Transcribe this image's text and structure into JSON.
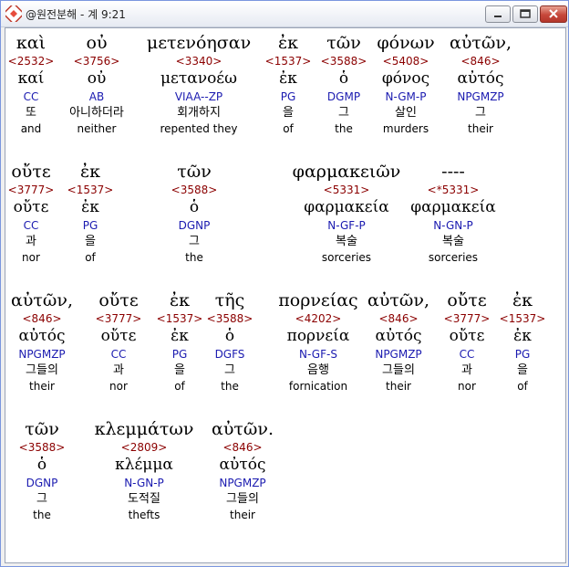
{
  "window": {
    "title": "@원전분해 - 계 9:21",
    "icon": "app-icon",
    "buttons": [
      "minimize-icon",
      "maximize-icon",
      "close-icon"
    ]
  },
  "rows": [
    [
      {
        "greek": "καὶ",
        "strong": "<2532>",
        "lemma": "καί",
        "parsing": "CC",
        "korean": "또",
        "english": "and"
      },
      {
        "greek": "οὐ",
        "strong": "<3756>",
        "lemma": "οὐ",
        "parsing": "AB",
        "korean": "아니하더라",
        "english": "neither"
      },
      {
        "greek": "μετενόησαν",
        "strong": "<3340>",
        "lemma": "μετανοέω",
        "parsing": "VIAA--ZP",
        "korean": "회개하지",
        "english": "repented they"
      },
      {
        "greek": "ἐκ",
        "strong": "<1537>",
        "lemma": "ἐκ",
        "parsing": "PG",
        "korean": "을",
        "english": "of"
      },
      {
        "greek": "τῶν",
        "strong": "<3588>",
        "lemma": "ὁ",
        "parsing": "DGMP",
        "korean": "그",
        "english": "the"
      },
      {
        "greek": "φόνων",
        "strong": "<5408>",
        "lemma": "φόνος",
        "parsing": "N-GM-P",
        "korean": "살인",
        "english": "murders"
      },
      {
        "greek": "αὐτῶν,",
        "strong": "<846>",
        "lemma": "αὐτός",
        "parsing": "NPGMZP",
        "korean": "그",
        "english": "their"
      }
    ],
    [
      {
        "greek": "οὔτε",
        "strong": "<3777>",
        "lemma": "οὔτε",
        "parsing": "CC",
        "korean": "과",
        "english": "nor"
      },
      {
        "greek": "ἐκ",
        "strong": "<1537>",
        "lemma": "ἐκ",
        "parsing": "PG",
        "korean": "을",
        "english": "of"
      },
      {
        "greek": "τῶν",
        "strong": "<3588>",
        "lemma": "ὁ",
        "parsing": "DGNP",
        "korean": "그",
        "english": "the"
      },
      {
        "greek": "φαρμακειῶν",
        "strong": "<5331>",
        "lemma": "φαρμακεία",
        "parsing": "N-GF-P",
        "korean": "복술",
        "english": "sorceries"
      },
      {
        "greek": "----",
        "strong": "<*5331>",
        "lemma": "φαρμακεία",
        "parsing": "N-GN-P",
        "korean": "복술",
        "english": "sorceries"
      }
    ],
    [
      {
        "greek": "αὐτῶν,",
        "strong": "<846>",
        "lemma": "αὐτός",
        "parsing": "NPGMZP",
        "korean": "그들의",
        "english": "their"
      },
      {
        "greek": "οὔτε",
        "strong": "<3777>",
        "lemma": "οὔτε",
        "parsing": "CC",
        "korean": "과",
        "english": "nor"
      },
      {
        "greek": "ἐκ",
        "strong": "<1537>",
        "lemma": "ἐκ",
        "parsing": "PG",
        "korean": "을",
        "english": "of"
      },
      {
        "greek": "τῆς",
        "strong": "<3588>",
        "lemma": "ὁ",
        "parsing": "DGFS",
        "korean": "그",
        "english": "the"
      },
      {
        "greek": "πορνείας",
        "strong": "<4202>",
        "lemma": "πορνεία",
        "parsing": "N-GF-S",
        "korean": "음행",
        "english": "fornication"
      },
      {
        "greek": "αὐτῶν,",
        "strong": "<846>",
        "lemma": "αὐτός",
        "parsing": "NPGMZP",
        "korean": "그들의",
        "english": "their"
      },
      {
        "greek": "οὔτε",
        "strong": "<3777>",
        "lemma": "οὔτε",
        "parsing": "CC",
        "korean": "과",
        "english": "nor"
      },
      {
        "greek": "ἐκ",
        "strong": "<1537>",
        "lemma": "ἐκ",
        "parsing": "PG",
        "korean": "을",
        "english": "of"
      }
    ],
    [
      {
        "greek": "τῶν",
        "strong": "<3588>",
        "lemma": "ὁ",
        "parsing": "DGNP",
        "korean": "그",
        "english": "the"
      },
      {
        "greek": "κλεμμάτων",
        "strong": "<2809>",
        "lemma": "κλέμμα",
        "parsing": "N-GN-P",
        "korean": "도적질",
        "english": "thefts"
      },
      {
        "greek": "αὐτῶν.",
        "strong": "<846>",
        "lemma": "αὐτός",
        "parsing": "NPGMZP",
        "korean": "그들의",
        "english": "their"
      }
    ]
  ],
  "colors": {
    "strong": "#8b0000",
    "parsing": "#1b1bb0",
    "text": "#000000"
  }
}
